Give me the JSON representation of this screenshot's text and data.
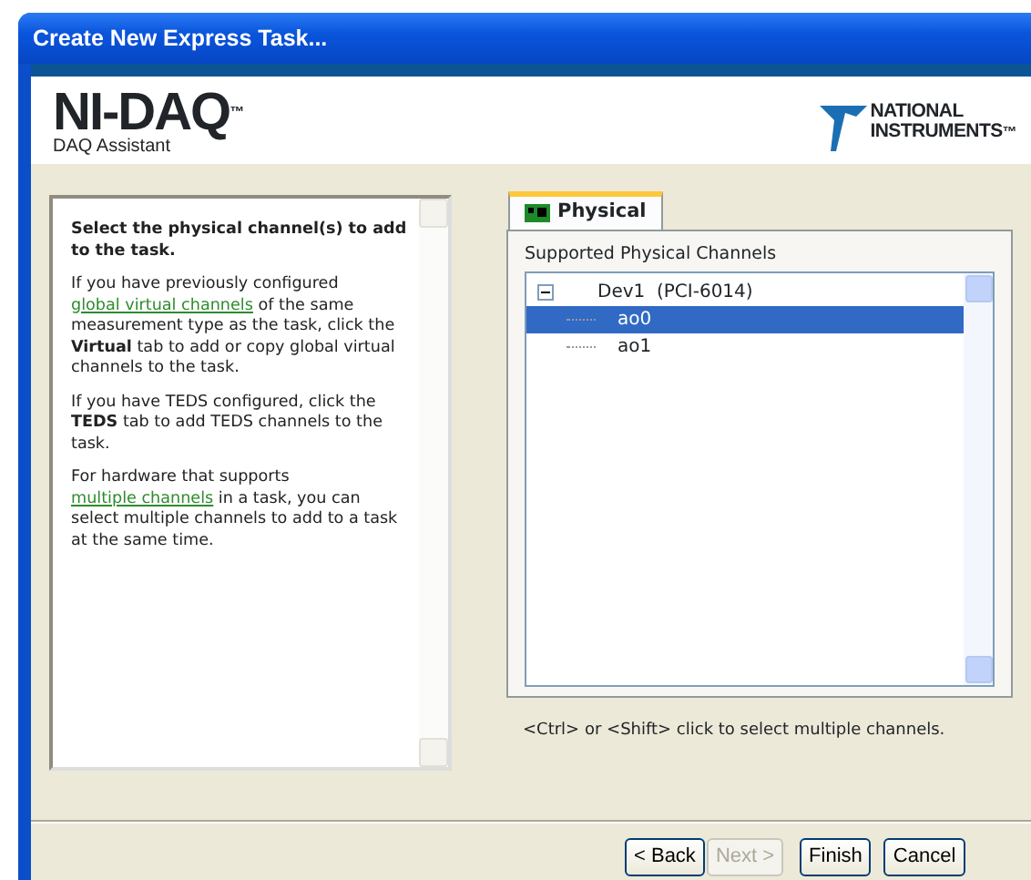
{
  "window": {
    "title": "Create New Express Task..."
  },
  "header": {
    "product": "NI-DAQ",
    "trademark": "™",
    "subtitle": "DAQ Assistant",
    "vendor_line_1": "NATIONAL",
    "vendor_line_2": "INSTRUMENTS",
    "vendor_trademark": "™"
  },
  "help": {
    "heading": "Select the physical channel(s) to add to the task.",
    "paragraphs": [
      [
        {
          "kind": "text",
          "text": "If you have previously configured "
        },
        {
          "kind": "link",
          "text": "global virtual channels"
        },
        {
          "kind": "text",
          "text": " of the same measurement type as the task, click the **Virtual** tab to add or copy global virtual channels to the task."
        }
      ],
      [
        {
          "kind": "text",
          "text": "If you have TEDS configured, click the **TEDS** tab to add TEDS channels to the task."
        }
      ],
      [
        {
          "kind": "text",
          "text": "For hardware that supports "
        },
        {
          "kind": "link",
          "text": "multiple channels"
        },
        {
          "kind": "text",
          "text": " in a task, you can select multiple channels to add to a task at the same time."
        }
      ]
    ]
  },
  "tabs": [
    {
      "label": "Physical",
      "selected": true
    }
  ],
  "channels": {
    "label": "Supported Physical Channels",
    "tree": [
      {
        "label": "Dev1  (PCI-6014)",
        "expanded": true,
        "selected": false,
        "children": [
          {
            "label": "ao0",
            "selected": true
          },
          {
            "label": "ao1",
            "selected": false
          }
        ]
      }
    ],
    "hint": "<Ctrl> or <Shift> click to select multiple channels."
  },
  "buttons": [
    {
      "label": "< Back",
      "disabled": false
    },
    {
      "label": "Next >",
      "disabled": true
    },
    {
      "label": "Finish",
      "disabled": false
    },
    {
      "label": "Cancel",
      "disabled": false
    }
  ]
}
